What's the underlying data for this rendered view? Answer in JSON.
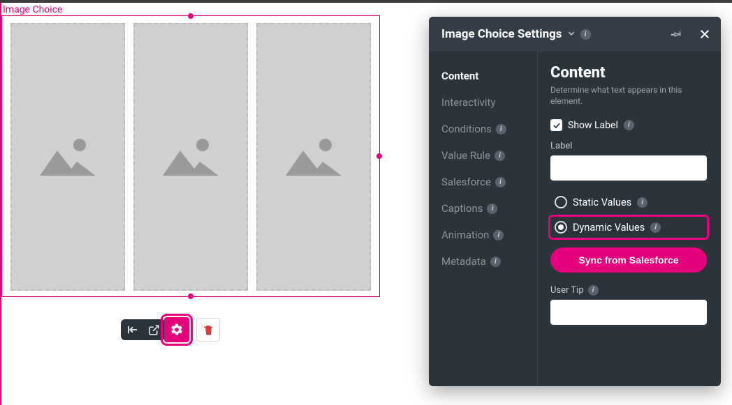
{
  "page_title": "Image Choice",
  "toolbar": {
    "insert_left": "insert-left",
    "open_external": "open-external",
    "settings": "settings",
    "delete": "delete"
  },
  "panel": {
    "title": "Image Choice Settings",
    "nav": [
      {
        "label": "Content",
        "active": true,
        "badge": false
      },
      {
        "label": "Interactivity",
        "active": false,
        "badge": false
      },
      {
        "label": "Conditions",
        "active": false,
        "badge": true
      },
      {
        "label": "Value Rule",
        "active": false,
        "badge": true
      },
      {
        "label": "Salesforce",
        "active": false,
        "badge": true
      },
      {
        "label": "Captions",
        "active": false,
        "badge": true
      },
      {
        "label": "Animation",
        "active": false,
        "badge": true
      },
      {
        "label": "Metadata",
        "active": false,
        "badge": true
      }
    ],
    "content": {
      "heading": "Content",
      "description": "Determine what text appears in this element.",
      "show_label_cb": "Show Label",
      "label_field": "Label",
      "label_value": "",
      "value_mode": [
        {
          "label": "Static Values",
          "selected": false,
          "info": true
        },
        {
          "label": "Dynamic Values",
          "selected": true,
          "info": true,
          "highlight": true
        }
      ],
      "sync_button": "Sync from Salesforce",
      "user_tip_label": "User Tip",
      "user_tip_value": ""
    }
  }
}
